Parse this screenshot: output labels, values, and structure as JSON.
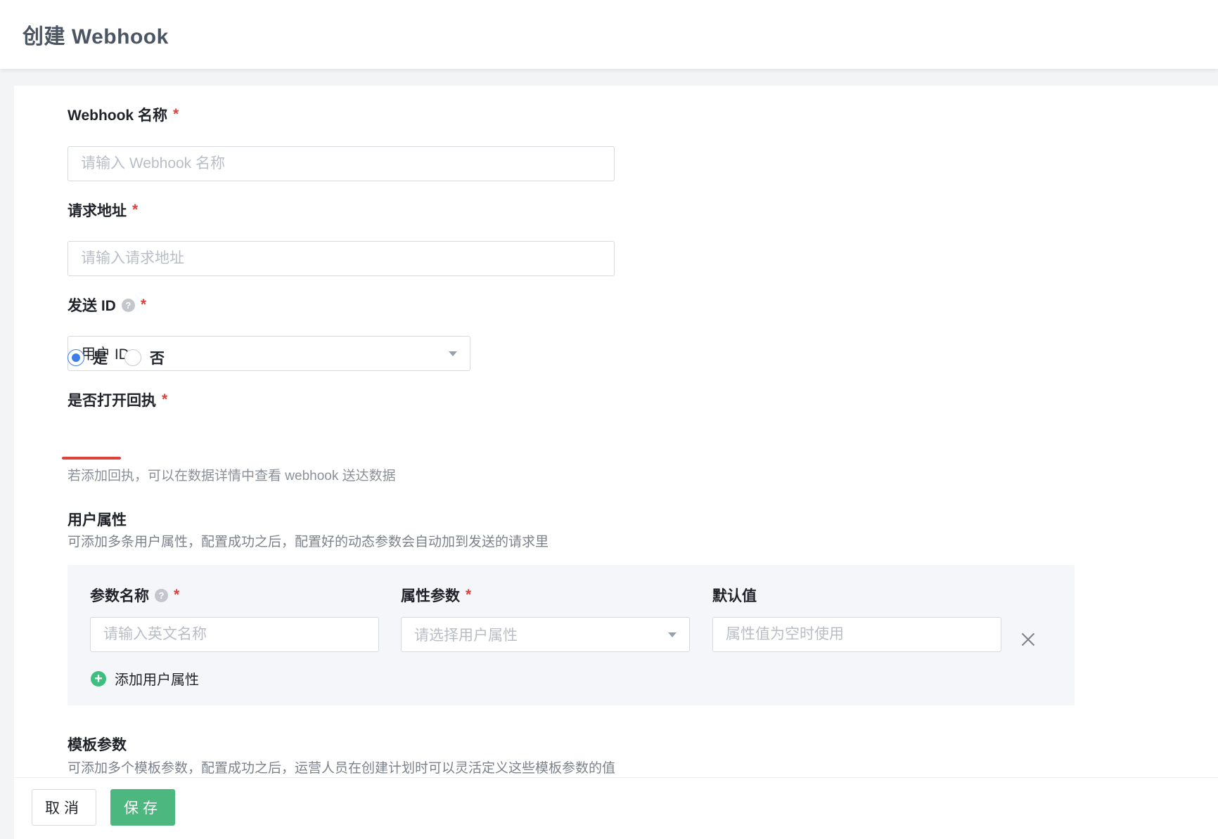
{
  "header": {
    "title": "创建 Webhook"
  },
  "form": {
    "name": {
      "label": "Webhook 名称",
      "required": "*",
      "placeholder": "请输入 Webhook 名称"
    },
    "url": {
      "label": "请求地址",
      "required": "*",
      "placeholder": "请输入请求地址"
    },
    "send_id": {
      "label": "发送 ID",
      "help": "?",
      "required": "*",
      "value": "用户 ID"
    },
    "receipt": {
      "label": "是否打开回执",
      "required": "*",
      "options": [
        {
          "label": "是",
          "checked": true
        },
        {
          "label": "否",
          "checked": false
        }
      ],
      "hint": "若添加回执，可以在数据详情中查看 webhook 送达数据"
    },
    "user_attrs": {
      "title": "用户属性",
      "desc": "可添加多条用户属性，配置成功之后，配置好的动态参数会自动加到发送的请求里",
      "columns": {
        "param_name": {
          "label": "参数名称",
          "help": "?",
          "required": "*",
          "placeholder": "请输入英文名称"
        },
        "attr_param": {
          "label": "属性参数",
          "required": "*",
          "placeholder": "请选择用户属性"
        },
        "default_value": {
          "label": "默认值",
          "placeholder": "属性值为空时使用"
        }
      },
      "add_label": "添加用户属性",
      "add_icon": "+"
    },
    "template_params": {
      "title": "模板参数",
      "desc": "可添加多个模板参数，配置成功之后，运营人员在创建计划时可以灵活定义这些模板参数的值"
    }
  },
  "footer": {
    "cancel_label": "取消",
    "save_label": "保存"
  },
  "colors": {
    "primary": "#3f7ee8",
    "save": "#4cb77f",
    "required": "#e0413b",
    "add_icon": "#3fbf7f"
  }
}
